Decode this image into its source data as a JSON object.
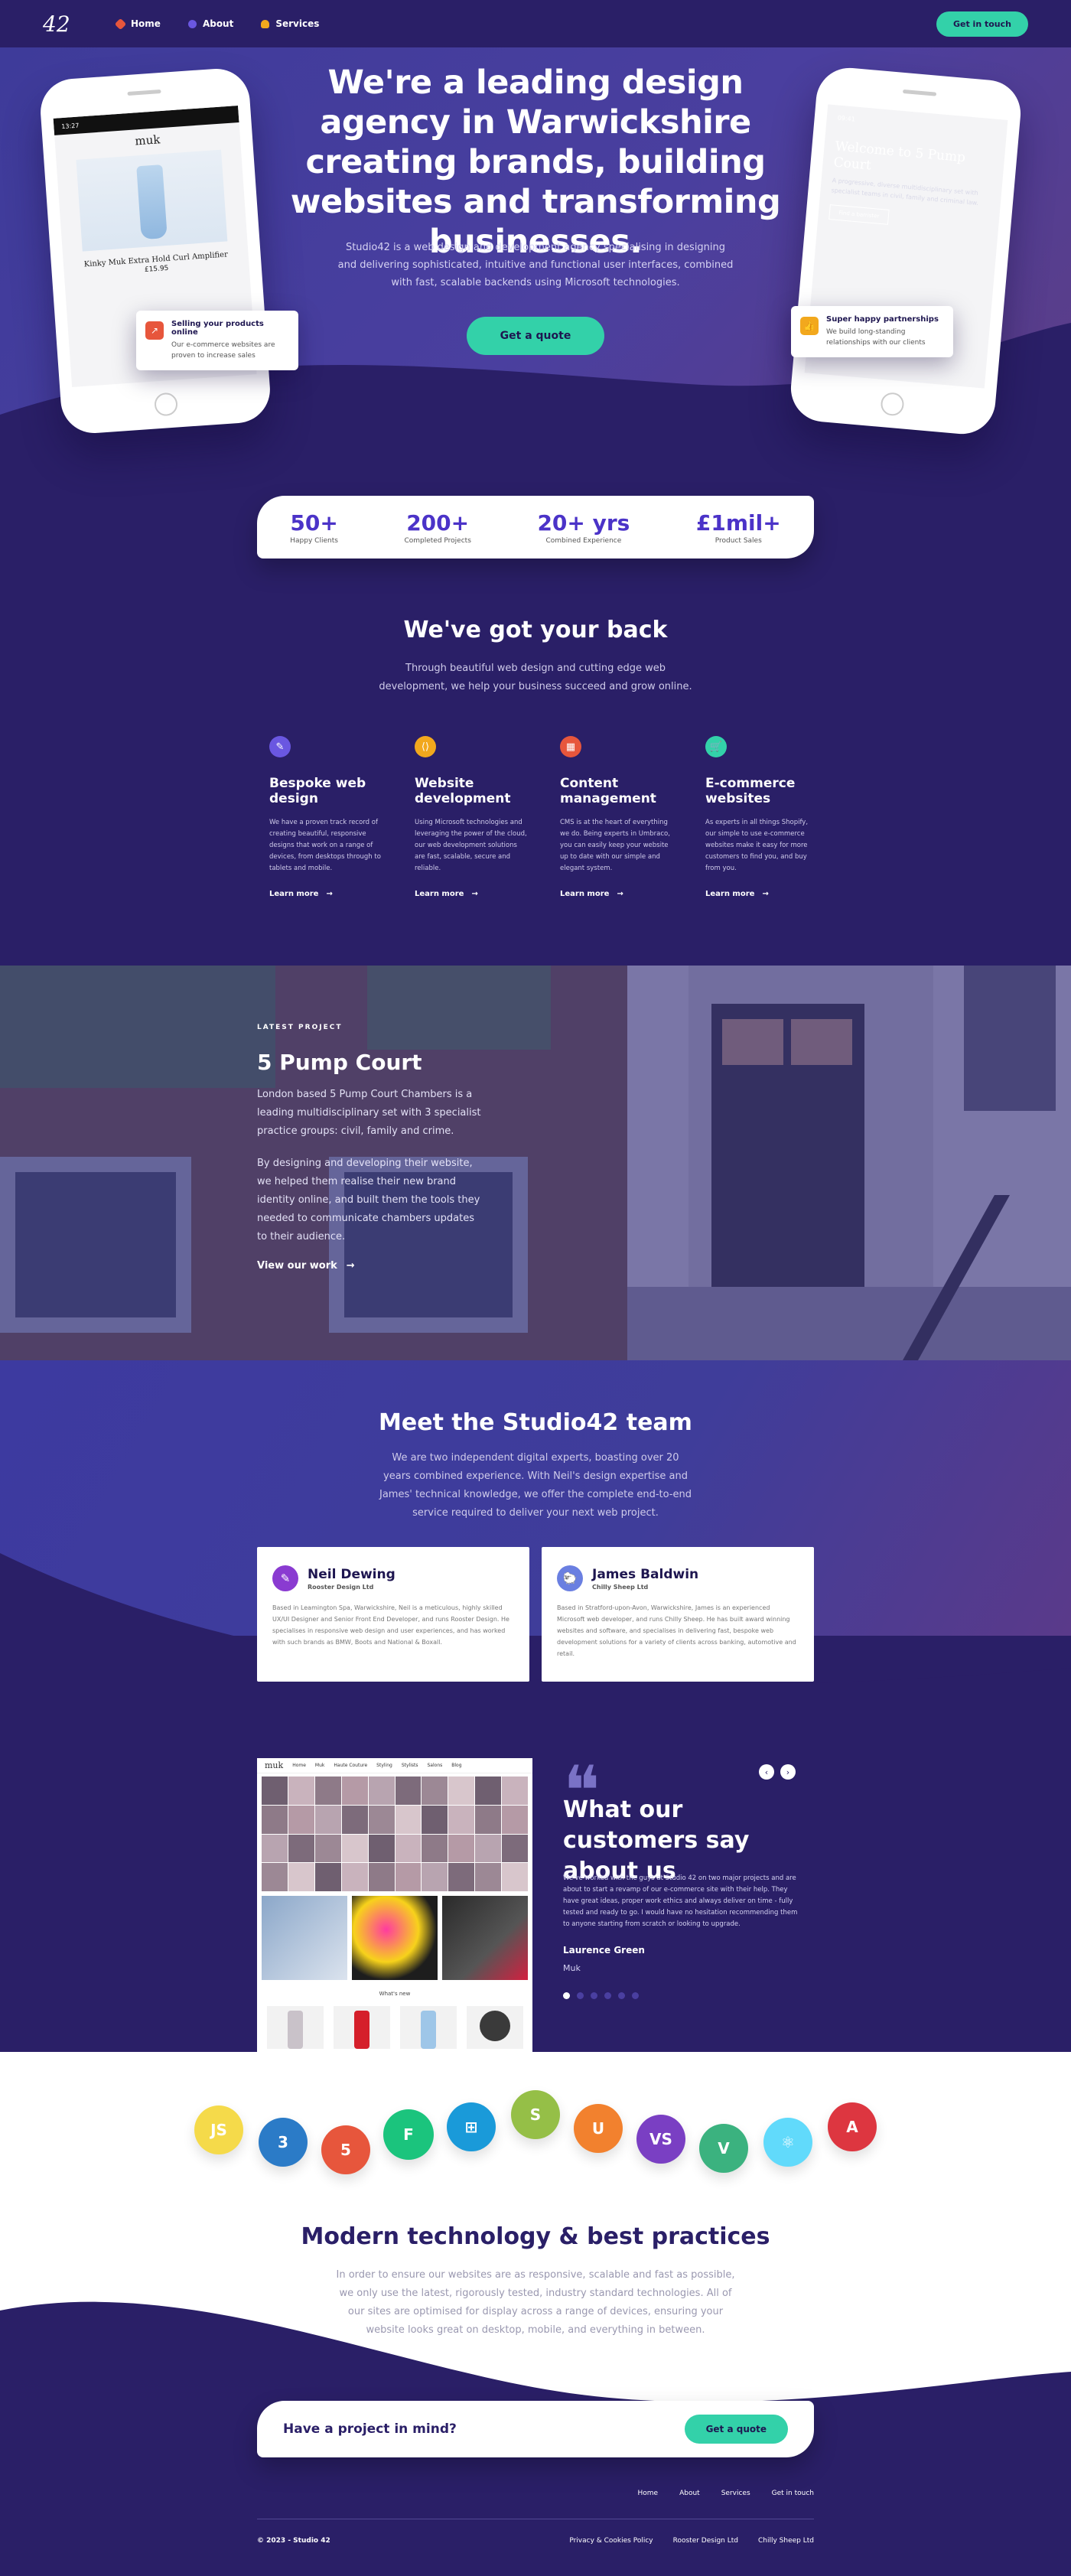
{
  "nav": {
    "logo": "42",
    "links": [
      {
        "label": "Home",
        "color": "#e7563c"
      },
      {
        "label": "About",
        "color": "#6a57e1"
      },
      {
        "label": "Services",
        "color": "#f2a81d"
      }
    ],
    "cta": "Get in touch"
  },
  "hero": {
    "title": "We're a leading design agency in Warwickshire creating brands, building websites and transforming businesses.",
    "text": "Studio42 is a web design and development agency specialising in designing and delivering sophisticated, intuitive and functional user interfaces, combined with fast, scalable backends using Microsoft technologies.",
    "cta": "Get a quote",
    "phone_left": {
      "time": "13:27",
      "brand": "muk",
      "product": "Kinky Muk Extra Hold Curl Amplifier",
      "price": "£15.95"
    },
    "phone_right": {
      "time": "09:41",
      "title": "Welcome to 5 Pump Court",
      "text": "A progressive, diverse multidisciplinary set with specialist teams in civil, family and criminal law.",
      "button": "Find a barrister"
    },
    "note_left": {
      "title": "Selling your products online",
      "text": "Our e-commerce websites are proven to increase sales"
    },
    "note_right": {
      "title": "Super happy partnerships",
      "text": "We build long-standing relationships with our clients"
    }
  },
  "stats": [
    {
      "value": "50+",
      "label": "Happy Clients"
    },
    {
      "value": "200+",
      "label": "Completed Projects"
    },
    {
      "value": "20+ yrs",
      "label": "Combined Experience"
    },
    {
      "value": "£1mil+",
      "label": "Product Sales"
    }
  ],
  "services": {
    "title": "We've got your back",
    "text": "Through beautiful web design and cutting edge web development, we help your business succeed and grow online.",
    "items": [
      {
        "icon": "pencil-icon",
        "color": "#6a57e1",
        "title": "Bespoke web design",
        "text": "We have a proven track record of creating beautiful, responsive designs that work on a range of devices, from desktops through to tablets and mobile.",
        "more": "Learn more"
      },
      {
        "icon": "code-icon",
        "color": "#f2a81d",
        "title": "Website development",
        "text": "Using Microsoft technologies and leveraging the power of the cloud, our web development solutions are fast, scalable, secure and reliable.",
        "more": "Learn more"
      },
      {
        "icon": "grid-icon",
        "color": "#e7563c",
        "title": "Content management",
        "text": "CMS is at the heart of everything we do. Being experts in Umbraco, you can easily keep your website up to date with our simple and elegant system.",
        "more": "Learn more"
      },
      {
        "icon": "cart-icon",
        "color": "#33d1a9",
        "title": "E-commerce websites",
        "text": "As experts in all things Shopify, our simple to use e-commerce websites make it easy for more customers to find you, and buy from you.",
        "more": "Learn more"
      }
    ]
  },
  "project": {
    "kicker": "LATEST PROJECT",
    "title": "5 Pump Court",
    "text1": "London based 5 Pump Court Chambers is a leading multidisciplinary set with 3 specialist practice groups: civil, family and crime.",
    "text2": "By designing and developing their website, we helped them realise their new brand identity online, and built them the tools they needed to communicate chambers updates to their audience.",
    "link": "View our work"
  },
  "team": {
    "title": "Meet the Studio42 team",
    "text": "We are two independent digital experts, boasting over 20 years combined experience. With Neil's design expertise and James' technical knowledge, we offer the complete end-to-end service required to deliver your next web project.",
    "members": [
      {
        "name": "Neil Dewing",
        "role": "Rooster Design Ltd",
        "color": "#8a3bd1",
        "bio": "Based in Leamington Spa, Warwickshire, Neil is a meticulous, highly skilled UX/UI Designer and Senior Front End Developer, and runs Rooster Design. He specialises in responsive web design and user experiences, and has worked with such brands as BMW, Boots and National & Boxall."
      },
      {
        "name": "James Baldwin",
        "role": "Chilly Sheep Ltd",
        "color": "#6a7fe1",
        "bio": "Based in Stratford-upon-Avon, Warwickshire, James is an experienced Microsoft web developer, and runs Chilly Sheep. He has built award winning websites and software, and specialises in delivering fast, bespoke web development solutions for a variety of clients across banking, automotive and retail."
      }
    ]
  },
  "testimonial": {
    "title": "What our customers say about us",
    "quote": "We've worked with the guys at Studio 42 on two major projects and are about to start a revamp of our e-commerce site with their help. They have great ideas, proper work ethics and always deliver on time - fully tested and ready to go. I would have no hesitation recommending them to anyone starting from scratch or looking to upgrade.",
    "name": "Laurence Green",
    "company": "Muk",
    "slides": 6,
    "shot": {
      "brand": "muk",
      "nav": [
        "Home",
        "Muk",
        "Haute Couture",
        "Styling",
        "Stylists",
        "Salons",
        "Blog"
      ],
      "footer": "What's new"
    }
  },
  "tech": {
    "title": "Modern technology & best practices",
    "text": "In order to ensure our websites are as responsive, scalable and fast as possible, we only use the latest, rigorously tested, industry standard technologies. All of our sites are optimised for display across a range of devices, ensuring your website looks great on desktop, mobile, and everything in between.",
    "logos": [
      {
        "name": "javascript-icon",
        "label": "JS",
        "color": "#f5da4a"
      },
      {
        "name": "css3-icon",
        "label": "3",
        "color": "#2b7bc7"
      },
      {
        "name": "html5-icon",
        "label": "5",
        "color": "#e7563c"
      },
      {
        "name": "figma-icon",
        "label": "F",
        "color": "#1bc47d"
      },
      {
        "name": "windows-icon",
        "label": "⊞",
        "color": "#1a9ad9"
      },
      {
        "name": "shopify-icon",
        "label": "S",
        "color": "#95bf47"
      },
      {
        "name": "umbraco-icon",
        "label": "U",
        "color": "#f2812e"
      },
      {
        "name": "visualstudio-icon",
        "label": "VS",
        "color": "#7a3fc3"
      },
      {
        "name": "vue-icon",
        "label": "V",
        "color": "#3bb27f"
      },
      {
        "name": "react-icon",
        "label": "⚛",
        "color": "#61dafb"
      },
      {
        "name": "angular-icon",
        "label": "A",
        "color": "#dd3640"
      }
    ]
  },
  "cta": {
    "title": "Have a project in mind?",
    "button": "Get a quote"
  },
  "footer": {
    "links": [
      "Home",
      "About",
      "Services",
      "Get in touch"
    ],
    "copyright": "© 2023 - Studio 42",
    "legal": [
      "Privacy & Cookies Policy",
      "Rooster Design Ltd",
      "Chilly Sheep Ltd"
    ]
  }
}
